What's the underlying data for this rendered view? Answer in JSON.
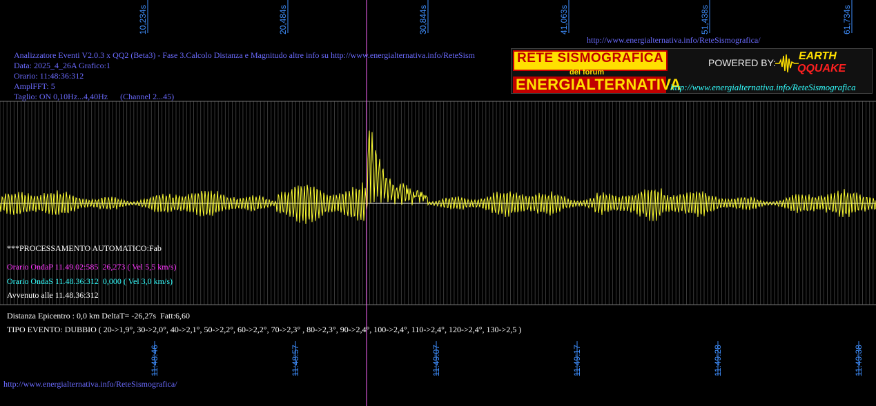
{
  "header": {
    "url_top": "http://www.energialternativa.info/ReteSismografica/",
    "title_line": "Analizzatore Eventi V2.0.3 x QQ2 (Beta3) - Fase 3.Calcolo Distanza e Magnitudo altre info su http://www.energialternativa.info/ReteSism",
    "data_line": "Data: 2025_4_26A Grafico:1",
    "orario_line": "Orario: 11:48:36:312",
    "ampl_line": "AmplFFT: 5",
    "taglio_line": "Taglio: ON 0,10Hz...4,40Hz      (Channel 2...45)"
  },
  "logo": {
    "title": "RETE SISMOGRAFICA",
    "forum": "del forum",
    "brand": "ENERGIALTERNATIVA",
    "powered": "POWERED BY:",
    "earth": "EARTH",
    "quake": "QQUAKE",
    "url": "http://www.energialternativa.info/ReteSismografica"
  },
  "top_ticks": [
    "10,234s",
    "20,484s",
    "30,844s",
    "41,063s",
    "51,438s",
    "61,734s"
  ],
  "bottom_ticks": [
    "11:48:46",
    "11:48:57",
    "11:49:07",
    "11:49:17",
    "11:49:28",
    "11:49:38"
  ],
  "processing": {
    "auto_label": "***PROCESSAMENTO AUTOMATICO:Fab",
    "onda_p": "Orario OndaP 11.49.02:585  26,273 ( Vel 5,5 km/s)",
    "onda_s": "Orario OndaS 11.48.36:312  0,000 ( Vel 3,0 km/s)",
    "avvenuto": "Avvenuto alle 11.48.36:312"
  },
  "result": {
    "distanza": "Distanza Epicentro : 0,0 km DeltaT= -26,27s  Fatt:6,60",
    "tipo_evento": "TIPO EVENTO: DUBBIO ( 20->1,9°, 30->2,0°, 40->2,1°, 50->2,2°, 60->2,2°, 70->2,3° , 80->2,3°, 90->2,4°, 100->2,4°, 110->2,4°, 120->2,4°, 130->2,5 )"
  },
  "footer": {
    "url": "http://www.energialternativa.info/ReteSismografica/"
  },
  "colors": {
    "signal": "#ffff33",
    "marker": "#ff66ff",
    "grid": "#555555",
    "baseline": "#ffffff",
    "info": "#6b6bff",
    "tick": "#3f8fff"
  }
}
